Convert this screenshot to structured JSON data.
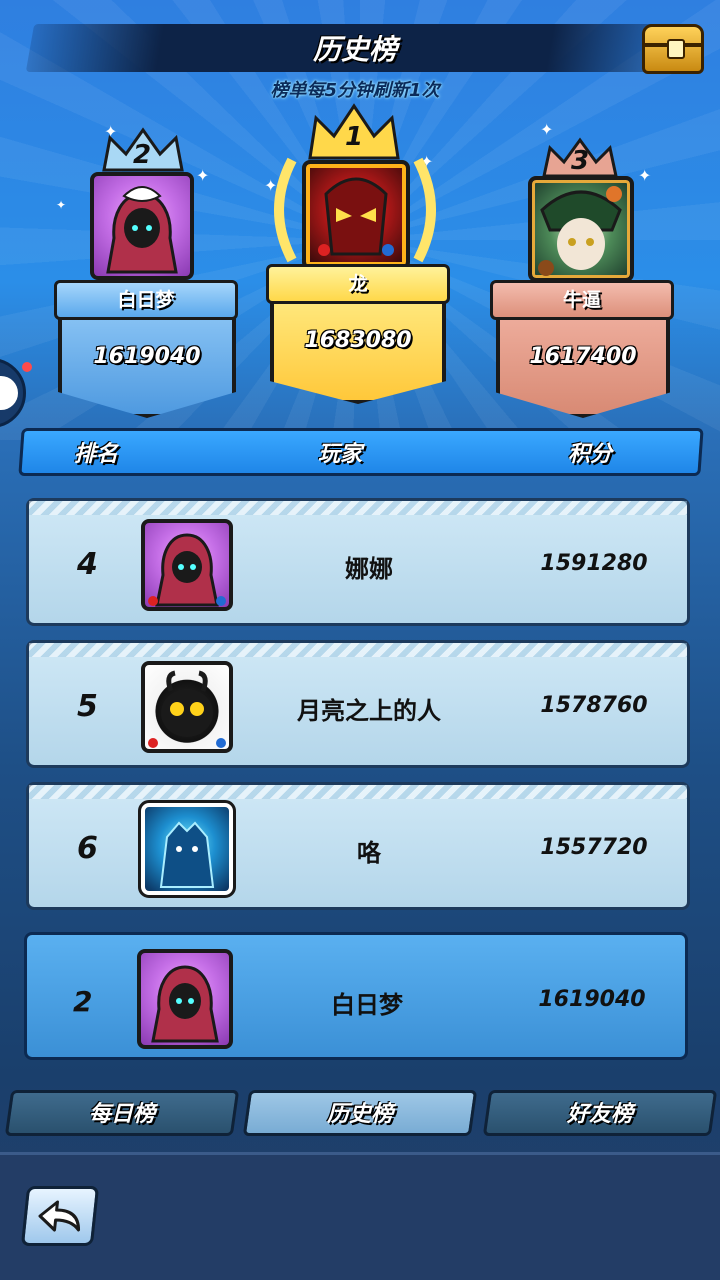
{
  "header": {
    "title": "历史榜",
    "subtitle": "榜单每5分钟刷新1次"
  },
  "podium": [
    {
      "rank": "2",
      "name": "白日梦",
      "score": "1619040"
    },
    {
      "rank": "1",
      "name": "龙",
      "score": "1683080"
    },
    {
      "rank": "3",
      "name": "牛逼",
      "score": "1617400"
    }
  ],
  "table": {
    "headers": [
      "排名",
      "玩家",
      "积分"
    ],
    "rows": [
      {
        "rank": "4",
        "name": "娜娜",
        "score": "1591280"
      },
      {
        "rank": "5",
        "name": "月亮之上的人",
        "score": "1578760"
      },
      {
        "rank": "6",
        "name": "咯",
        "score": "1557720"
      }
    ]
  },
  "self": {
    "rank": "2",
    "name": "白日梦",
    "score": "1619040"
  },
  "tabs": [
    "每日榜",
    "历史榜",
    "好友榜"
  ],
  "active_tab": "历史榜",
  "icons": {
    "chest": "treasure-chest-icon",
    "back": "back-arrow-icon",
    "crown": "crown-icon"
  },
  "colors": {
    "gold": "#ffd84a",
    "silver": "#7fc4f5",
    "bronze": "#e39a85",
    "row_bg": "#c4e0f1",
    "self_row_bg": "#4aa0e6"
  }
}
